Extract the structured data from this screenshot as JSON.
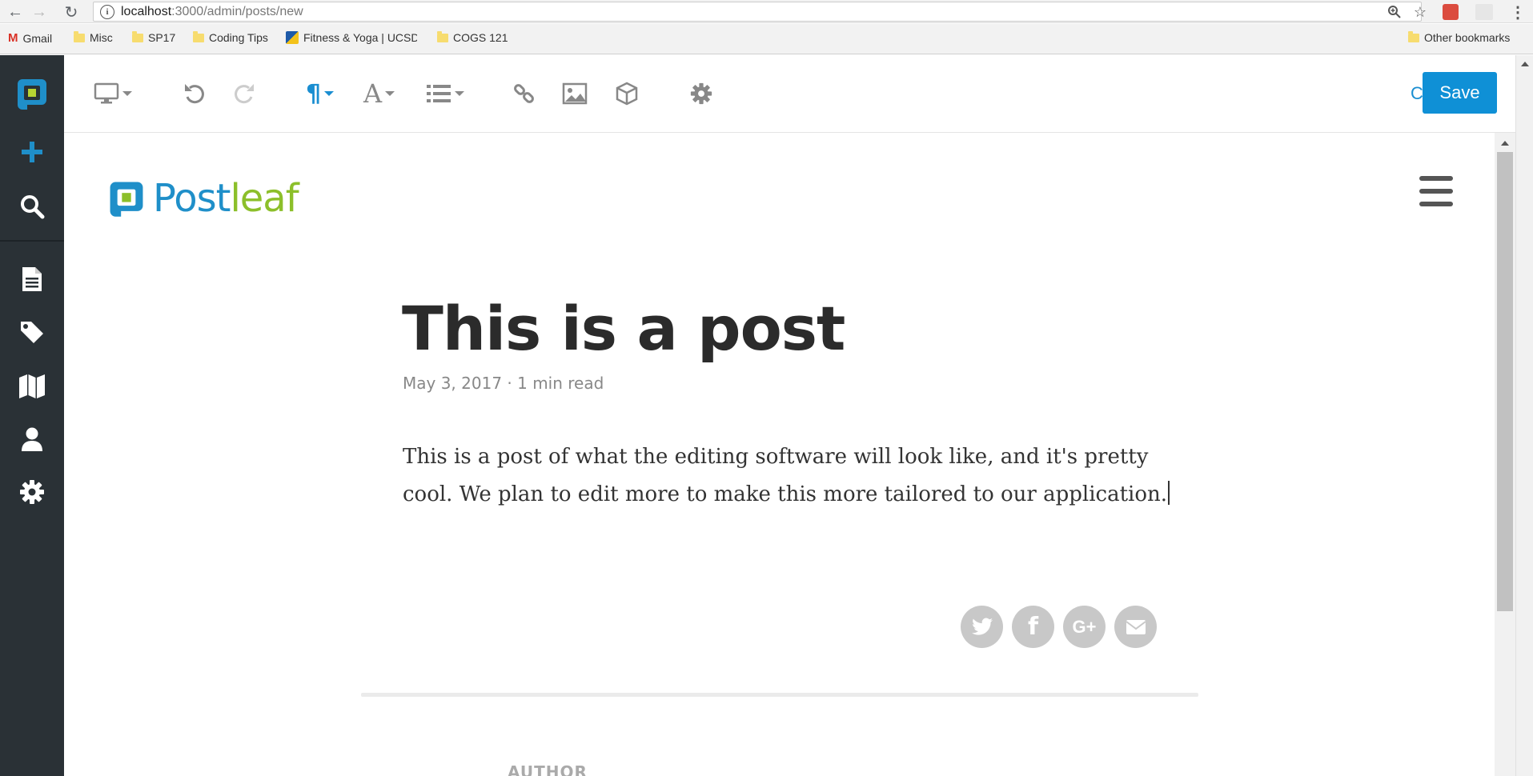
{
  "browser": {
    "url_host": "localhost",
    "url_path": ":3000/admin/posts/new",
    "bookmarks": [
      {
        "label": "Gmail"
      },
      {
        "label": "Misc"
      },
      {
        "label": "SP17"
      },
      {
        "label": "Coding Tips"
      },
      {
        "label": "Fitness & Yoga | UCSD"
      },
      {
        "label": "COGS 121"
      }
    ],
    "other_bookmarks": "Other bookmarks"
  },
  "sidebar": {
    "items": [
      {
        "icon": "postleaf-logo-icon"
      },
      {
        "icon": "plus-icon"
      },
      {
        "icon": "search-icon"
      },
      {
        "icon": "document-icon"
      },
      {
        "icon": "tag-icon"
      },
      {
        "icon": "map-icon"
      },
      {
        "icon": "user-icon"
      },
      {
        "icon": "gear-icon"
      }
    ]
  },
  "toolbar": {
    "cancel_label": "Cancel",
    "save_label": "Save"
  },
  "site": {
    "logo_part1": "Post",
    "logo_part2": "leaf"
  },
  "post": {
    "title": "This is a post",
    "meta": "May 3, 2017 · 1 min read",
    "body": "This is a post of what the editing software will look like, and it's pretty cool. We plan to edit more to make this more tailored to our application.",
    "author_label": "AUTHOR"
  },
  "colors": {
    "sidebar_bg": "#2a3136",
    "accent": "#0f90d6",
    "logo_blue": "#1f8fc9",
    "logo_green": "#8cbf2a"
  }
}
